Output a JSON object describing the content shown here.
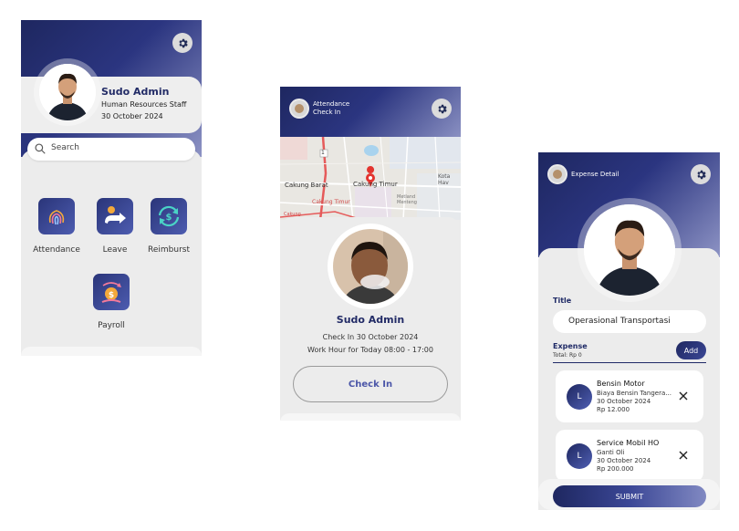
{
  "profile": {
    "name": "Sudo Admin",
    "role": "Human Resources Staff",
    "date": "30 October 2024",
    "search_placeholder": "Search",
    "menu": [
      {
        "label": "Attendance"
      },
      {
        "label": "Leave"
      },
      {
        "label": "Reimburst"
      },
      {
        "label": "Payroll"
      }
    ]
  },
  "attendance": {
    "header_line1": "Attendance",
    "header_line2": "Check In",
    "map_labels": [
      "Cakung Barat",
      "Cakung Timur",
      "Cakung Timur",
      "Metland Menteng",
      "Kota Hav",
      "Cakung",
      "1"
    ],
    "name": "Sudo Admin",
    "check_in_text": "Check In 30 October 2024",
    "work_hour": "Work Hour for Today 08:00 - 17:00",
    "button": "Check In"
  },
  "expense": {
    "header": "Expense Detail",
    "title_label": "Title",
    "title_value": "Operasional Transportasi",
    "expense_label": "Expense",
    "total": "Total: Rp 0",
    "add_button": "Add",
    "items": [
      {
        "initial": "L",
        "title": "Bensin Motor",
        "desc": "Biaya Bensin Tangera...",
        "date": "30 October 2024",
        "amount": "Rp 12.000"
      },
      {
        "initial": "L",
        "title": "Service Mobil HO",
        "desc": "Ganti Oli",
        "date": "30 October 2024",
        "amount": "Rp 200.000"
      }
    ],
    "submit": "SUBMIT"
  },
  "colors": {
    "primary": "#1f2a66",
    "accent": "#4b56a8",
    "sheet": "#ececec"
  }
}
